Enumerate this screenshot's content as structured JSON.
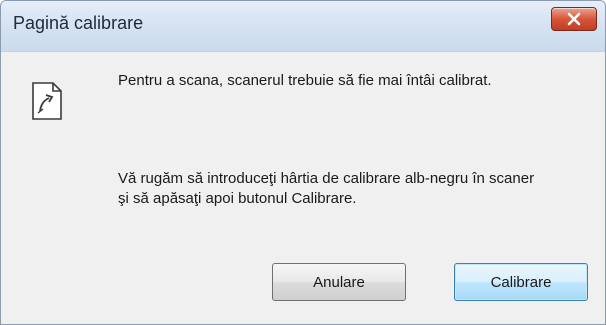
{
  "window": {
    "title": "Pagină calibrare"
  },
  "message": {
    "line1": "Pentru a scana, scanerul trebuie să fie mai întâi calibrat.",
    "line2": "Vă rugăm să introduceţi hârtia de calibrare alb-negru în scaner",
    "line3": "şi să apăsaţi apoi butonul Calibrare."
  },
  "buttons": {
    "cancel_label": "Anulare",
    "calibrate_label": "Calibrare"
  },
  "icons": {
    "close": "close-icon",
    "document": "document-arrow-icon"
  },
  "colors": {
    "close_button": "#c23d22",
    "default_button_border": "#3c7fb1",
    "titlebar": "#d7e3f2",
    "client_background": "#f0f0f0"
  }
}
